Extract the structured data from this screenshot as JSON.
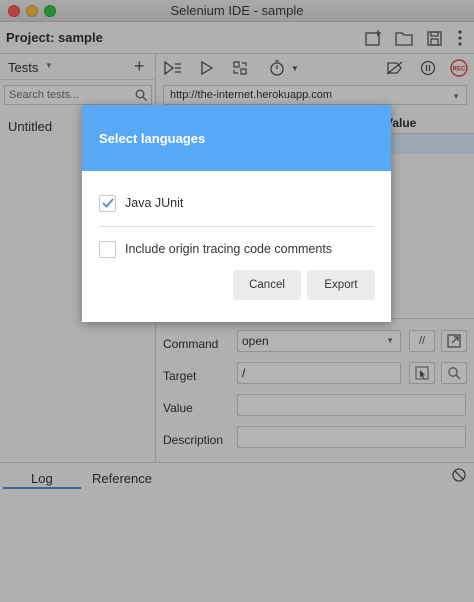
{
  "window": {
    "title": "Selenium IDE - sample"
  },
  "project": {
    "label": "Project:",
    "name": "sample"
  },
  "sidebar": {
    "tests_label": "Tests",
    "search_placeholder": "Search tests...",
    "items": [
      {
        "label": "Untitled"
      }
    ]
  },
  "main": {
    "url": "http://the-internet.herokuapp.com",
    "table_header_value": "Value",
    "editor": {
      "command_label": "Command",
      "command_value": "open",
      "target_label": "Target",
      "target_value": "/",
      "value_label": "Value",
      "value_value": "",
      "description_label": "Description",
      "description_value": "",
      "comment_btn": "//"
    }
  },
  "bottom": {
    "tabs": [
      {
        "label": "Log"
      },
      {
        "label": "Reference"
      }
    ]
  },
  "dialog": {
    "title": "Select languages",
    "options": [
      {
        "label": "Java JUnit",
        "checked": true
      },
      {
        "label": "Include origin tracing code comments",
        "checked": false
      }
    ],
    "cancel_label": "Cancel",
    "export_label": "Export"
  },
  "colors": {
    "accent": "#58a8f5",
    "checkmark": "#4a90d9",
    "record": "#d9342b"
  },
  "icons": [
    "new-project-icon",
    "open-project-icon",
    "save-project-icon",
    "more-icon",
    "run-all-icon",
    "run-icon",
    "run-step-icon",
    "speed-icon",
    "disable-breakpoints-icon",
    "pause-icon",
    "record-icon",
    "search-icon",
    "chevron-down-icon",
    "select-target-icon",
    "find-target-icon",
    "open-reference-icon",
    "clear-log-icon"
  ]
}
